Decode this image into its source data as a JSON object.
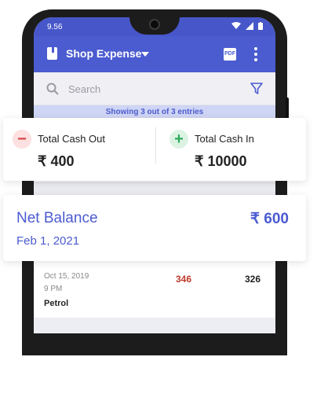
{
  "status_bar": {
    "time": "9.56"
  },
  "app_bar": {
    "title": "Shop Expense",
    "icons": [
      "book-icon",
      "chevron-down-icon",
      "pdf-icon",
      "more-vert-icon"
    ]
  },
  "search": {
    "placeholder": "Search"
  },
  "entries_text": "Showing 3 out of 3 entries",
  "summary": {
    "cash_out_label": "Total Cash Out",
    "cash_out_amount": "₹ 400",
    "cash_in_label": "Total Cash In",
    "cash_in_amount": "₹ 10000"
  },
  "net_balance": {
    "label": "Net Balance",
    "amount": "₹ 600",
    "date": "Feb 1, 2021"
  },
  "transaction": {
    "date": "Oct 15, 2019",
    "time": "9 PM",
    "description": "Petrol",
    "cash_out": "346",
    "balance": "326"
  },
  "colors": {
    "primary": "#4b5bd0",
    "cash_out": "#d64545",
    "cash_in": "#2eaa5c"
  }
}
